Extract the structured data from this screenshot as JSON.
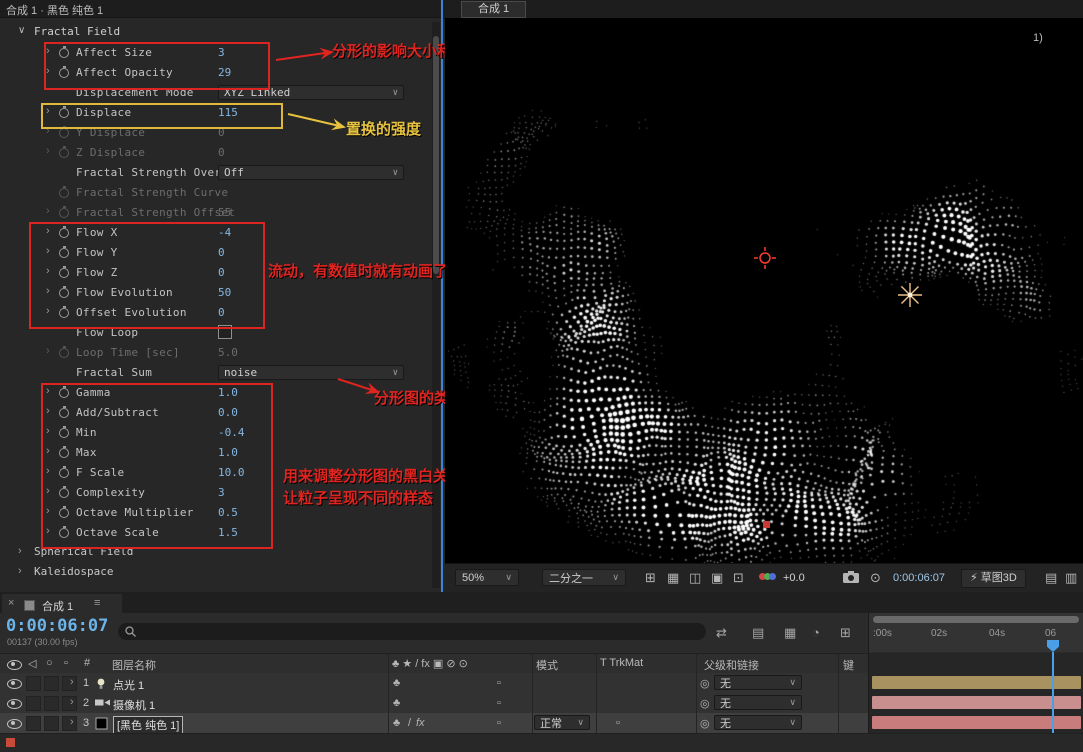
{
  "icons": {
    "chev": "›",
    "group_open": "∨",
    "dd": "∨",
    "close": "×",
    "menu": "≡",
    "pickwhip": "◎",
    "quality": "♣",
    "fx": "fx",
    "slash": "/",
    "hash": "#",
    "audio": "◁",
    "solo": "○",
    "box": "▫",
    "bolt": "⚡",
    "snapshot": "⊙",
    "v": [
      "⊞",
      "▦",
      "◫",
      "▣",
      "⊡"
    ],
    "t": [
      "⇄",
      "▤",
      "▦",
      "◔",
      "⊞"
    ],
    "end": [
      "▤",
      "▥"
    ]
  },
  "effect_panel": {
    "tab": "合成 1 · 黑色 纯色 1",
    "group": "Fractal Field",
    "rows": [
      {
        "name": "Affect Size",
        "value": "3",
        "type": "value",
        "chevron": true,
        "stopwatch": true
      },
      {
        "name": "Affect Opacity",
        "value": "29",
        "type": "value",
        "chevron": true,
        "stopwatch": true
      },
      {
        "name": "Displacement Mode",
        "value": "XYZ Linked",
        "type": "dropdown"
      },
      {
        "name": "Displace",
        "value": "115",
        "type": "value",
        "chevron": true,
        "stopwatch": true
      },
      {
        "name": "Y Displace",
        "value": "0",
        "type": "value",
        "chevron": true,
        "stopwatch": true,
        "disabled": true
      },
      {
        "name": "Z Displace",
        "value": "0",
        "type": "value",
        "chevron": true,
        "stopwatch": true,
        "disabled": true
      },
      {
        "name": "Fractal Strength Over",
        "value": "Off",
        "type": "dropdown"
      },
      {
        "name": "Fractal Strength Curve",
        "value": "",
        "type": "none",
        "stopwatch": true,
        "disabled": true
      },
      {
        "name": "Fractal Strength Offset",
        "value": "55",
        "type": "value",
        "chevron": true,
        "stopwatch": true,
        "disabled": true
      },
      {
        "name": "Flow X",
        "value": "-4",
        "type": "value",
        "chevron": true,
        "stopwatch": true
      },
      {
        "name": "Flow Y",
        "value": "0",
        "type": "value",
        "chevron": true,
        "stopwatch": true
      },
      {
        "name": "Flow Z",
        "value": "0",
        "type": "value",
        "chevron": true,
        "stopwatch": true
      },
      {
        "name": "Flow Evolution",
        "value": "50",
        "type": "value",
        "chevron": true,
        "stopwatch": true
      },
      {
        "name": "Offset Evolution",
        "value": "0",
        "type": "value",
        "chevron": true,
        "stopwatch": true
      },
      {
        "name": "Flow Loop",
        "value": "",
        "type": "checkbox"
      },
      {
        "name": "Loop Time [sec]",
        "value": "5.0",
        "type": "value",
        "chevron": true,
        "stopwatch": true,
        "disabled": true
      },
      {
        "name": "Fractal Sum",
        "value": "noise",
        "type": "dropdown"
      },
      {
        "name": "Gamma",
        "value": "1.0",
        "type": "value",
        "chevron": true,
        "stopwatch": true
      },
      {
        "name": "Add/Subtract",
        "value": "0.0",
        "type": "value",
        "chevron": true,
        "stopwatch": true
      },
      {
        "name": "Min",
        "value": "-0.4",
        "type": "value",
        "chevron": true,
        "stopwatch": true
      },
      {
        "name": "Max",
        "value": "1.0",
        "type": "value",
        "chevron": true,
        "stopwatch": true
      },
      {
        "name": "F Scale",
        "value": "10.0",
        "type": "value",
        "chevron": true,
        "stopwatch": true
      },
      {
        "name": "Complexity",
        "value": "3",
        "type": "value",
        "chevron": true,
        "stopwatch": true
      },
      {
        "name": "Octave Multiplier",
        "value": "0.5",
        "type": "value",
        "chevron": true,
        "stopwatch": true
      },
      {
        "name": "Octave Scale",
        "value": "1.5",
        "type": "value",
        "chevron": true,
        "stopwatch": true
      }
    ],
    "footer_groups": [
      "Spherical Field",
      "Kaleidospace"
    ]
  },
  "annotations": {
    "affect": "分形的影响大小和不透明度",
    "displace": "置换的强度",
    "flow": "流动，有数值时就有动画了",
    "fractal_type": "分形图的类型",
    "adjust_line1": "用来调整分形图的黑白关系",
    "adjust_line2": "让粒子呈现不同的样态"
  },
  "viewer": {
    "tab": "合成 1",
    "corner_label": "1)",
    "toolbar": {
      "zoom": "50%",
      "resolution": "二分之一",
      "exposure": "+0.0",
      "time": "0:00:06:07",
      "draft": "草图3D"
    }
  },
  "timeline": {
    "tab": "合成 1",
    "timecode": "0:00:06:07",
    "frame_info": "00137 (30.00 fps)",
    "columns": {
      "hash": "#",
      "layer_name": "图层名称",
      "switch_header": "♣ ★ / fx ▣ ⊘ ⊙",
      "mode": "模式",
      "trkmat": "T TrkMat",
      "parent": "父级和链接",
      "key": "键"
    },
    "ruler": [
      ":00s",
      "02s",
      "04s",
      "06"
    ],
    "layers": [
      {
        "index": "1",
        "name": "点光 1",
        "parent": "无",
        "bar_color": "#a8925f"
      },
      {
        "index": "2",
        "name": "摄像机 1",
        "parent": "无",
        "bar_color": "#c98f8f"
      },
      {
        "index": "3",
        "name": "[黑色 纯色 1]",
        "mode": "正常",
        "parent": "无",
        "bar_color": "#c97c7c",
        "selected": true
      }
    ]
  }
}
